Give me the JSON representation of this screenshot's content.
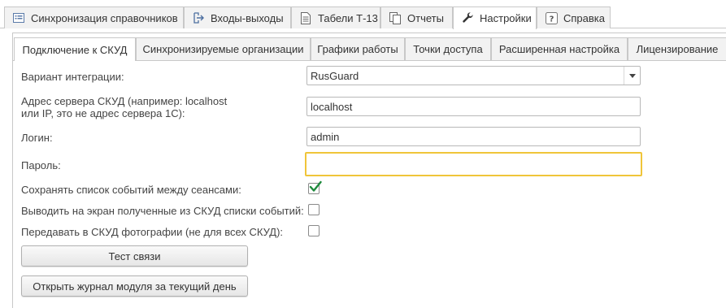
{
  "top_tabs": [
    {
      "label": "Синхронизация справочников",
      "icon": "list-icon",
      "active": false
    },
    {
      "label": "Входы-выходы",
      "icon": "entries-exits-icon",
      "active": false
    },
    {
      "label": "Табели Т-13",
      "icon": "document-icon",
      "active": false
    },
    {
      "label": "Отчеты",
      "icon": "reports-icon",
      "active": false
    },
    {
      "label": "Настройки",
      "icon": "wrench-icon",
      "active": true
    },
    {
      "label": "Справка",
      "icon": "help-icon",
      "active": false
    }
  ],
  "sub_tabs": [
    {
      "label": "Подключение к СКУД",
      "active": true
    },
    {
      "label": "Синхронизируемые организации",
      "active": false
    },
    {
      "label": "Графики работы",
      "active": false
    },
    {
      "label": "Точки доступа",
      "active": false
    },
    {
      "label": "Расширенная настройка",
      "active": false
    },
    {
      "label": "Лицензирование",
      "active": false
    }
  ],
  "form": {
    "integration_label": "Вариант интеграции:",
    "integration_value": "RusGuard",
    "server_label_line1": "Адрес сервера СКУД (например: localhost",
    "server_label_line2": "или IP, это не адрес сервера 1С):",
    "server_value": "localhost",
    "login_label": "Логин:",
    "login_value": "admin",
    "password_label": "Пароль:",
    "password_value": "",
    "save_events_label": "Сохранять список событий между сеансами:",
    "save_events_checked": true,
    "show_events_label": "Выводить на экран полученные из СКУД списки событий:",
    "show_events_checked": false,
    "send_photos_label": "Передавать в СКУД фотографии (не для всех СКУД):",
    "send_photos_checked": false
  },
  "buttons": {
    "test_connection": "Тест связи",
    "open_log": "Открыть журнал модуля за текущий день"
  },
  "colors": {
    "focus_border": "#f0c53a",
    "checkmark": "#1e8a3c",
    "tab_inactive_bg": "#f2f2f2",
    "border": "#c8c8c8"
  }
}
